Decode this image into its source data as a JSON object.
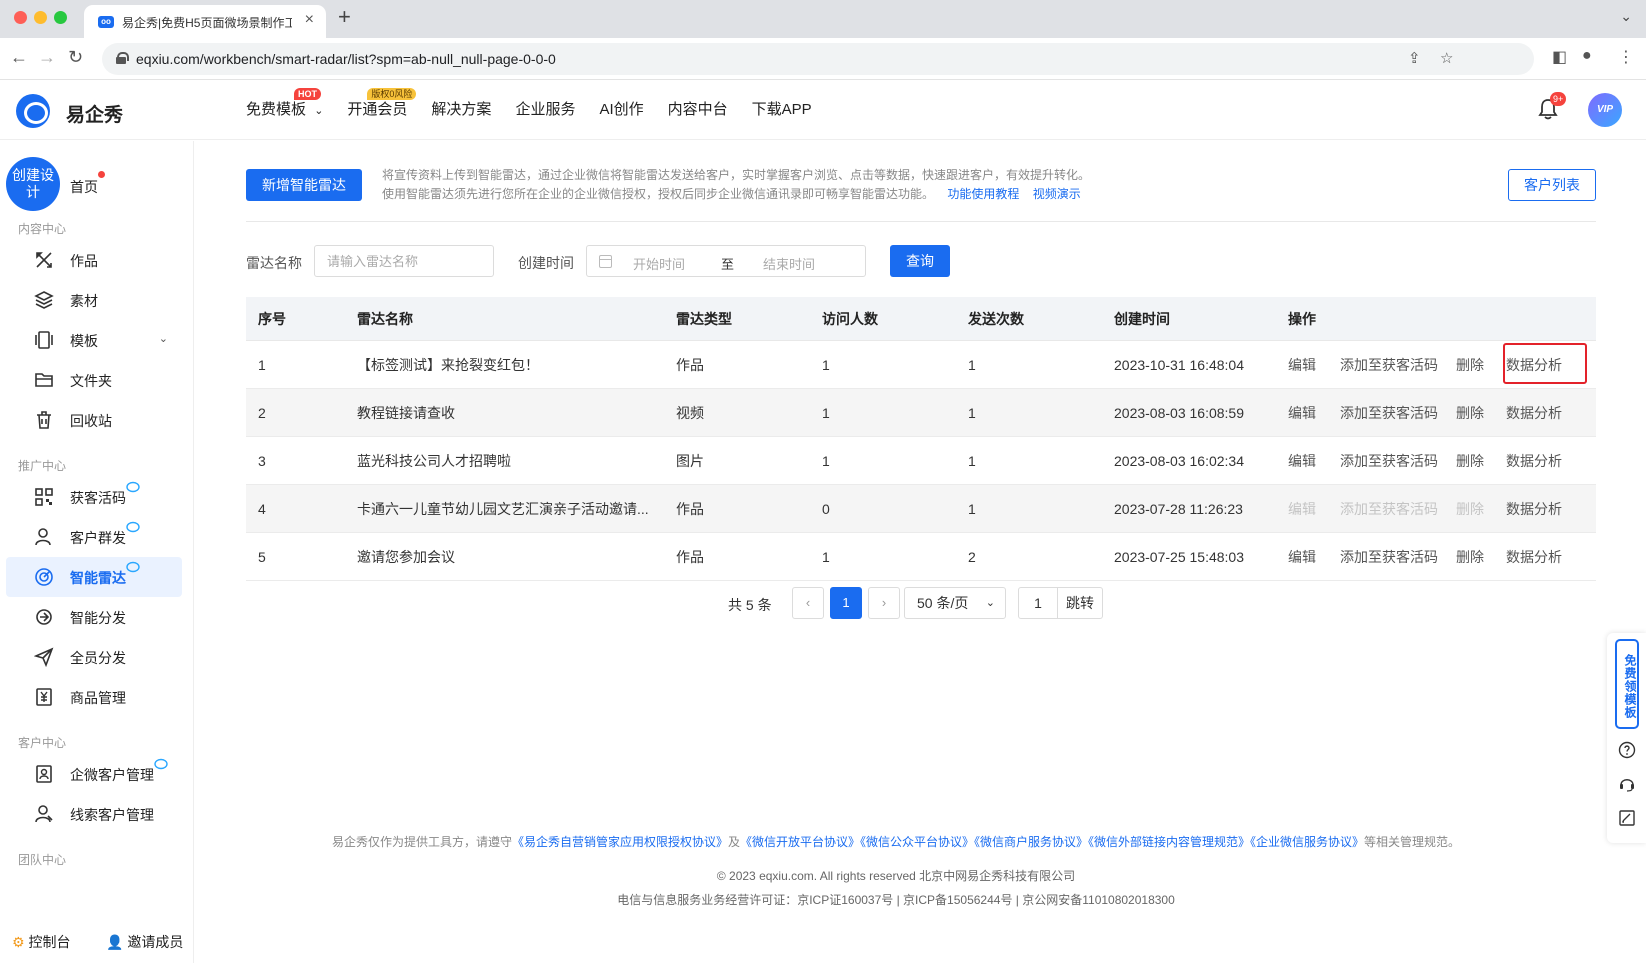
{
  "browser": {
    "tab_title": "易企秀|免费H5页面微场景制作工具",
    "tab_favicon": "oo",
    "url": "eqxiu.com/workbench/smart-radar/list?spm=ab-null_null-page-0-0-0"
  },
  "header": {
    "logo_text": "易企秀",
    "nav": [
      {
        "label": "免费模板",
        "badge": "HOT",
        "has_chevron": true
      },
      {
        "label": "开通会员",
        "badge": "版权0风险"
      },
      {
        "label": "解决方案"
      },
      {
        "label": "企业服务"
      },
      {
        "label": "AI创作"
      },
      {
        "label": "内容中台"
      },
      {
        "label": "下载APP"
      }
    ],
    "notification_count": "9+",
    "avatar_label": "VIP"
  },
  "sidebar": {
    "create_button": "创建设计",
    "home": "首页",
    "sections": [
      {
        "title": "内容中心",
        "items": [
          {
            "label": "作品",
            "icon": "works-icon"
          },
          {
            "label": "素材",
            "icon": "layers-icon"
          },
          {
            "label": "模板",
            "icon": "template-icon",
            "expandable": true
          },
          {
            "label": "文件夹",
            "icon": "folder-icon"
          },
          {
            "label": "回收站",
            "icon": "trash-icon"
          }
        ]
      },
      {
        "title": "推广中心",
        "items": [
          {
            "label": "获客活码",
            "icon": "qrcode-icon",
            "ai": true
          },
          {
            "label": "客户群发",
            "icon": "user-broadcast-icon",
            "ai": true
          },
          {
            "label": "智能雷达",
            "icon": "radar-icon",
            "ai": true,
            "active": true
          },
          {
            "label": "智能分发",
            "icon": "smart-distribute-icon"
          },
          {
            "label": "全员分发",
            "icon": "send-icon"
          },
          {
            "label": "商品管理",
            "icon": "yen-icon"
          }
        ]
      },
      {
        "title": "客户中心",
        "items": [
          {
            "label": "企微客户管理",
            "icon": "contact-card-icon",
            "ai": true
          },
          {
            "label": "线索客户管理",
            "icon": "users-icon"
          }
        ]
      },
      {
        "title": "团队中心",
        "items": []
      }
    ],
    "footer": {
      "console": "控制台",
      "invite": "邀请成员"
    }
  },
  "main": {
    "new_radar_button": "新增智能雷达",
    "desc_line1": "将宣传资料上传到智能雷达，通过企业微信将智能雷达发送给客户，实时掌握客户浏览、点击等数据，快速跟进客户，有效提升转化。",
    "desc_line2": "使用智能雷达须先进行您所在企业的企业微信授权，授权后同步企业微信通讯录即可畅享智能雷达功能。",
    "tutorial_link": "功能使用教程",
    "video_link": "视频演示",
    "customer_list_button": "客户列表",
    "filter": {
      "name_label": "雷达名称",
      "name_placeholder": "请输入雷达名称",
      "time_label": "创建时间",
      "start_placeholder": "开始时间",
      "separator": "至",
      "end_placeholder": "结束时间",
      "query_button": "查询"
    },
    "table": {
      "headers": {
        "idx": "序号",
        "name": "雷达名称",
        "type": "雷达类型",
        "visitors": "访问人数",
        "sends": "发送次数",
        "created": "创建时间",
        "ops": "操作"
      },
      "ops": {
        "edit": "编辑",
        "add": "添加至获客活码",
        "delete": "删除",
        "analysis": "数据分析"
      },
      "rows": [
        {
          "idx": "1",
          "name": "【标签测试】来抢裂变红包！",
          "type": "作品",
          "visitors": "1",
          "sends": "1",
          "created": "2023-10-31 16:48:04",
          "ops_disabled": false
        },
        {
          "idx": "2",
          "name": "教程链接请查收",
          "type": "视频",
          "visitors": "1",
          "sends": "1",
          "created": "2023-08-03 16:08:59",
          "ops_disabled": false
        },
        {
          "idx": "3",
          "name": "蓝光科技公司人才招聘啦",
          "type": "图片",
          "visitors": "1",
          "sends": "1",
          "created": "2023-08-03 16:02:34",
          "ops_disabled": false
        },
        {
          "idx": "4",
          "name": "卡通六一儿童节幼儿园文艺汇演亲子活动邀请...",
          "type": "作品",
          "visitors": "0",
          "sends": "1",
          "created": "2023-07-28 11:26:23",
          "ops_disabled": true
        },
        {
          "idx": "5",
          "name": "邀请您参加会议",
          "type": "作品",
          "visitors": "1",
          "sends": "2",
          "created": "2023-07-25 15:48:03",
          "ops_disabled": false
        }
      ]
    },
    "pagination": {
      "total": "共 5 条",
      "current_page": "1",
      "page_size": "50 条/页",
      "jump_value": "1",
      "jump_button": "跳转"
    }
  },
  "footer": {
    "legal_prefix": "易企秀仅作为提供工具方，请遵守",
    "legal_link1": "《易企秀自营销管家应用权限授权协议》",
    "legal_and": "及",
    "legal_links": "《微信开放平台协议》《微信公众平台协议》《微信商户服务协议》《微信外部链接内容管理规范》《企业微信服务协议》",
    "legal_suffix": "等相关管理规范。",
    "copyright": "© 2023 eqxiu.com. All rights reserved 北京中网易企秀科技有限公司",
    "icp": "电信与信息服务业务经营许可证：京ICP证160037号 | 京ICP备15056244号 | 京公网安备11010802018300"
  },
  "float_bar": {
    "free_template": "免费领模板"
  },
  "colors": {
    "primary": "#1a6cf0",
    "highlight_border": "#e3222a",
    "badge_red": "#f5433d"
  }
}
